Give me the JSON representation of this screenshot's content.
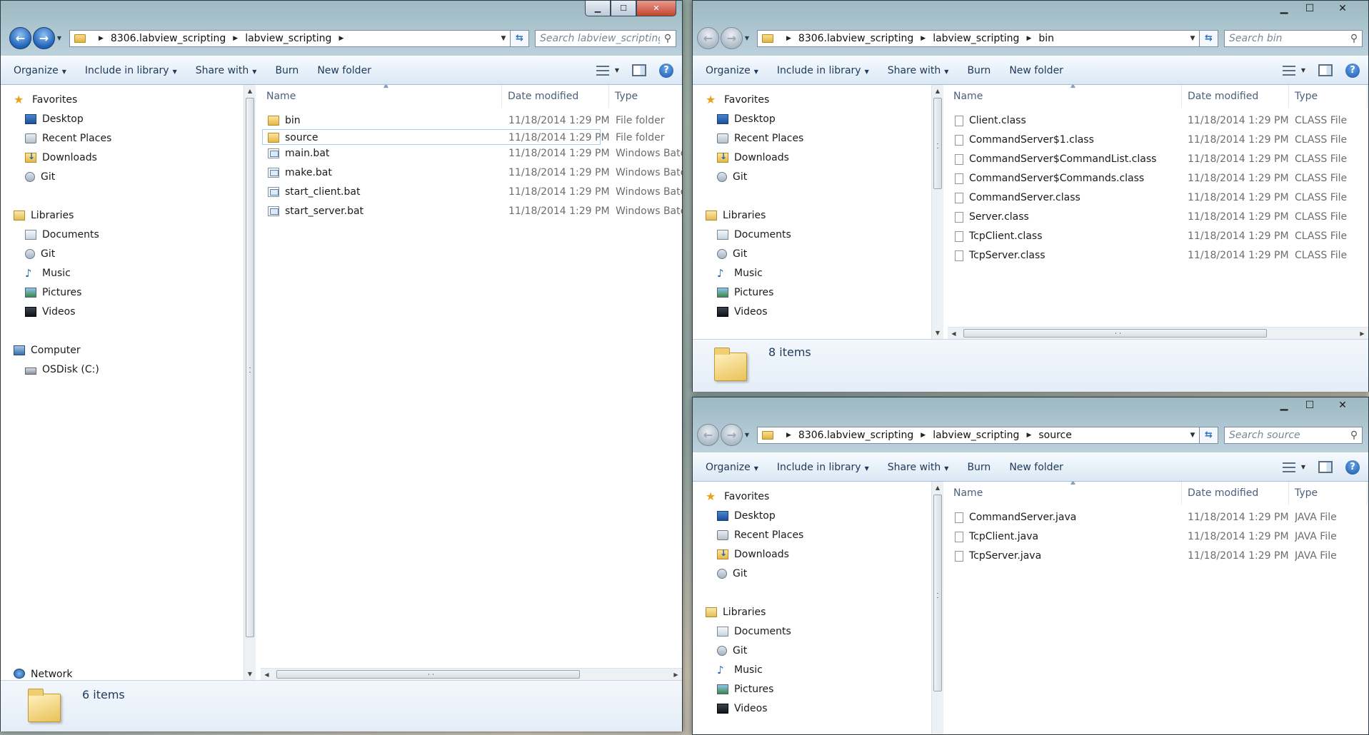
{
  "windows": {
    "main": {
      "caption_buttons": [
        "minimize",
        "maximize",
        "close"
      ],
      "breadcrumb": [
        "8306.labview_scripting",
        "labview_scripting"
      ],
      "search_placeholder": "Search labview_scripting",
      "toolbar": {
        "organize": "Organize",
        "include_in_library": "Include in library",
        "share_with": "Share with",
        "burn": "Burn",
        "new_folder": "New folder"
      },
      "nav": {
        "favorites": "Favorites",
        "desktop": "Desktop",
        "recent_places": "Recent Places",
        "downloads": "Downloads",
        "git": "Git",
        "libraries": "Libraries",
        "documents": "Documents",
        "lib_git": "Git",
        "music": "Music",
        "pictures": "Pictures",
        "videos": "Videos",
        "computer": "Computer",
        "osdisk": "OSDisk (C:)",
        "network": "Network"
      },
      "columns": {
        "name": "Name",
        "date_modified": "Date modified",
        "type": "Type"
      },
      "files": [
        {
          "name": "bin",
          "date": "11/18/2014 1:29 PM",
          "type": "File folder"
        },
        {
          "name": "source",
          "date": "11/18/2014 1:29 PM",
          "type": "File folder"
        },
        {
          "name": "main.bat",
          "date": "11/18/2014 1:29 PM",
          "type": "Windows Batc"
        },
        {
          "name": "make.bat",
          "date": "11/18/2014 1:29 PM",
          "type": "Windows Batc"
        },
        {
          "name": "start_client.bat",
          "date": "11/18/2014 1:29 PM",
          "type": "Windows Batc"
        },
        {
          "name": "start_server.bat",
          "date": "11/18/2014 1:29 PM",
          "type": "Windows Batc"
        }
      ],
      "item_count": "6 items"
    },
    "bin": {
      "breadcrumb": [
        "8306.labview_scripting",
        "labview_scripting",
        "bin"
      ],
      "search_placeholder": "Search bin",
      "toolbar": {
        "organize": "Organize",
        "include_in_library": "Include in library",
        "share_with": "Share with",
        "burn": "Burn",
        "new_folder": "New folder"
      },
      "nav": {
        "favorites": "Favorites",
        "desktop": "Desktop",
        "recent_places": "Recent Places",
        "downloads": "Downloads",
        "git": "Git",
        "libraries": "Libraries",
        "documents": "Documents",
        "lib_git": "Git",
        "music": "Music",
        "pictures": "Pictures",
        "videos": "Videos"
      },
      "columns": {
        "name": "Name",
        "date_modified": "Date modified",
        "type": "Type"
      },
      "files": [
        {
          "name": "Client.class",
          "date": "11/18/2014 1:29 PM",
          "type": "CLASS File"
        },
        {
          "name": "CommandServer$1.class",
          "date": "11/18/2014 1:29 PM",
          "type": "CLASS File"
        },
        {
          "name": "CommandServer$CommandList.class",
          "date": "11/18/2014 1:29 PM",
          "type": "CLASS File"
        },
        {
          "name": "CommandServer$Commands.class",
          "date": "11/18/2014 1:29 PM",
          "type": "CLASS File"
        },
        {
          "name": "CommandServer.class",
          "date": "11/18/2014 1:29 PM",
          "type": "CLASS File"
        },
        {
          "name": "Server.class",
          "date": "11/18/2014 1:29 PM",
          "type": "CLASS File"
        },
        {
          "name": "TcpClient.class",
          "date": "11/18/2014 1:29 PM",
          "type": "CLASS File"
        },
        {
          "name": "TcpServer.class",
          "date": "11/18/2014 1:29 PM",
          "type": "CLASS File"
        }
      ],
      "item_count": "8 items"
    },
    "source": {
      "breadcrumb": [
        "8306.labview_scripting",
        "labview_scripting",
        "source"
      ],
      "search_placeholder": "Search source",
      "toolbar": {
        "organize": "Organize",
        "include_in_library": "Include in library",
        "share_with": "Share with",
        "burn": "Burn",
        "new_folder": "New folder"
      },
      "nav": {
        "favorites": "Favorites",
        "desktop": "Desktop",
        "recent_places": "Recent Places",
        "downloads": "Downloads",
        "git": "Git",
        "libraries": "Libraries",
        "documents": "Documents",
        "lib_git": "Git",
        "music": "Music",
        "pictures": "Pictures",
        "videos": "Videos"
      },
      "columns": {
        "name": "Name",
        "date_modified": "Date modified",
        "type": "Type"
      },
      "files": [
        {
          "name": "CommandServer.java",
          "date": "11/18/2014 1:29 PM",
          "type": "JAVA File"
        },
        {
          "name": "TcpClient.java",
          "date": "11/18/2014 1:29 PM",
          "type": "JAVA File"
        },
        {
          "name": "TcpServer.java",
          "date": "11/18/2014 1:29 PM",
          "type": "JAVA File"
        }
      ]
    }
  },
  "icons": {
    "back": "back-arrow-icon",
    "forward": "forward-arrow-icon",
    "refresh": "refresh-icon",
    "search": "search-icon",
    "help": "help-icon"
  }
}
